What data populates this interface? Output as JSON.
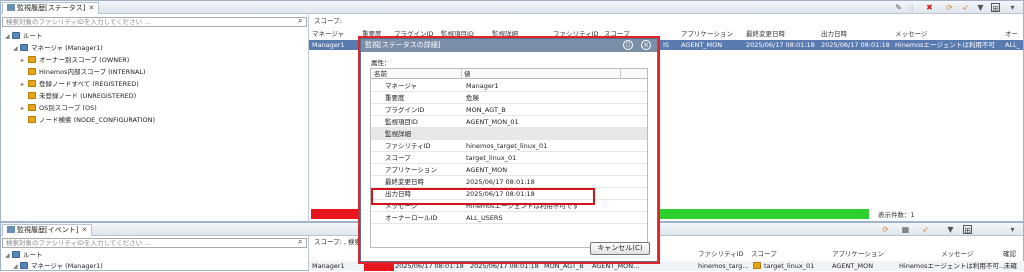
{
  "top_panel": {
    "tab_label": "監視履歴[ステータス]",
    "search_placeholder": "検索対象のファシリティIDを入力してください ...",
    "scope_label": "スコープ:",
    "tree": [
      "ルート",
      "マネージャ (Manager1)",
      "オーナー別スコープ (OWNER)",
      "Hinemos内部スコープ (INTERNAL)",
      "登録ノードすべて (REGISTERED)",
      "未登録ノード (UNREGISTERED)",
      "OS別スコープ (OS)",
      "ノード検索 (NODE_CONFIGURATION)"
    ],
    "columns": [
      "マネージャ",
      "重要度",
      "プラグインID",
      "監視項目ID",
      "監視詳細",
      "ファシリティID",
      "スコープ",
      "アプリケーション",
      "最終変更日時",
      "出力日時",
      "メッセージ",
      "オー"
    ],
    "row": {
      "manager": "Manager1",
      "facility_tail": "IS",
      "application": "AGENT_MON",
      "last_changed": "2025/06/17 08:01:18",
      "output": "2025/06/17 08:01:18",
      "message": "Hinemosエージェントは利用不可",
      "owner": "ALL_"
    },
    "status_text": "表示件数：1",
    "status_colors": {
      "red": "#e8161c",
      "green": "#2ed02e"
    }
  },
  "bottom_panel": {
    "tab_label": "監視履歴[イベント]",
    "search_placeholder": "検索対象のファシリティIDを入力してください ...",
    "scope_label": "スコープ: , 検索",
    "tree": [
      "ルート",
      "マネージャ (Manager1)"
    ],
    "columns": [
      "ファシリティID",
      "スコープ",
      "アプリケーション",
      "メッセージ",
      "確認"
    ],
    "row": {
      "manager": "Manager1",
      "received": "2025/06/17 08:01:18",
      "output": "2025/06/17 08:01:18",
      "plugin": "MON_AGT_B",
      "monitor": "AGENT_MON...",
      "facility": "hinemos_targ...",
      "scope": "target_linux_01",
      "application": "AGENT_MON",
      "message": "Hinemosエージェントは利用不可...",
      "confirm": "未確"
    }
  },
  "dialog": {
    "title": "監視[ステータスの詳細]",
    "attr_label": "属性：",
    "col_name": "名前",
    "col_value": "値",
    "rows": [
      {
        "k": "マネージャ",
        "v": "Manager1"
      },
      {
        "k": "重要度",
        "v": "危険"
      },
      {
        "k": "プラグインID",
        "v": "MON_AGT_B"
      },
      {
        "k": "監視項目ID",
        "v": "AGENT_MON_01"
      },
      {
        "k": "監視詳細",
        "v": ""
      },
      {
        "k": "ファシリティID",
        "v": "hinemos_target_linux_01"
      },
      {
        "k": "スコープ",
        "v": "target_linux_01"
      },
      {
        "k": "アプリケーション",
        "v": "AGENT_MON"
      },
      {
        "k": "最終変更日時",
        "v": "2025/06/17 08:01:18"
      },
      {
        "k": "出力日時",
        "v": "2025/06/17 08:01:18"
      },
      {
        "k": "メッセージ",
        "v": "Hinemosエージェントは利用不可です"
      },
      {
        "k": "オーナーロールID",
        "v": "ALL_USERS"
      }
    ],
    "cancel_label": "キャンセル(C)"
  }
}
